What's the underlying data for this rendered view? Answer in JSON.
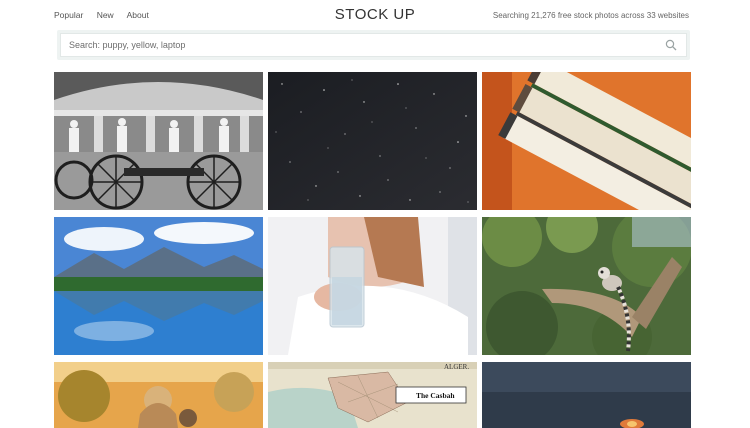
{
  "nav": {
    "items": [
      {
        "label": "Popular"
      },
      {
        "label": "New"
      },
      {
        "label": "About"
      }
    ]
  },
  "brand": {
    "title": "STOCK UP"
  },
  "header": {
    "tagline": "Searching 21,276 free stock photos across 33 websites"
  },
  "search": {
    "placeholder": "Search: puppy, yellow, laptop",
    "value": "",
    "icon": "search-icon"
  },
  "photos": [
    {
      "row": 1,
      "col": 1,
      "subject": "black and white statues and cannon wheels"
    },
    {
      "row": 1,
      "col": 2,
      "subject": "starry night sky"
    },
    {
      "row": 1,
      "col": 3,
      "subject": "stack of books on orange background"
    },
    {
      "row": 2,
      "col": 1,
      "subject": "mountain lake with reflection"
    },
    {
      "row": 2,
      "col": 2,
      "subject": "woman holding glass of water"
    },
    {
      "row": 2,
      "col": 3,
      "subject": "lemur on tree branch"
    },
    {
      "row": 3,
      "col": 1,
      "subject": "woman in golden field"
    },
    {
      "row": 3,
      "col": 2,
      "subject": "vintage map of Alger",
      "map_labels": [
        "ALGER.",
        "The Casbah"
      ]
    },
    {
      "row": 3,
      "col": 3,
      "subject": "dark sky with fire"
    }
  ]
}
